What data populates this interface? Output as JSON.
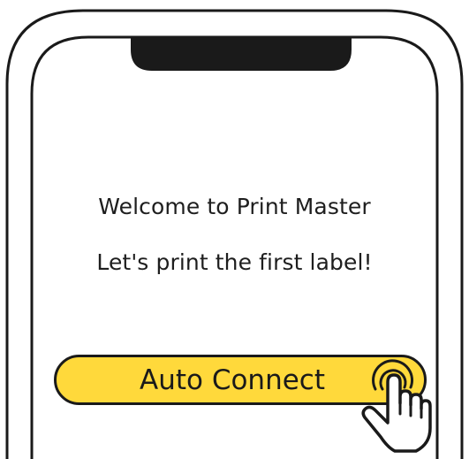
{
  "screen": {
    "welcome": "Welcome to Print Master",
    "tagline": "Let's print the first label!"
  },
  "actions": {
    "auto_connect_label": "Auto Connect"
  },
  "icons": {
    "pointer": "tap-hand-icon"
  },
  "colors": {
    "outline": "#1a1a1a",
    "button_fill": "#ffd93b",
    "background": "#ffffff"
  }
}
